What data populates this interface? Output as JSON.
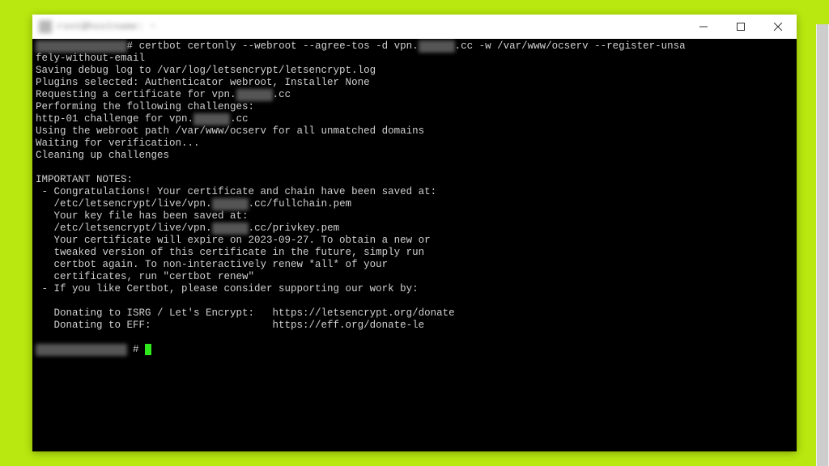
{
  "window": {
    "title": "root@hostname: ~"
  },
  "terminal": {
    "prompt_redacted": "root@████████:~",
    "prompt_hash": "#",
    "cmd_part1": "certbot certonly --webroot --agree-tos -d vpn.",
    "cmd_red1": "██████",
    "cmd_part2": ".cc -w /var/www/ocserv --register-unsa",
    "line2": "fely-without-email",
    "line3": "Saving debug log to /var/log/letsencrypt/letsencrypt.log",
    "line4": "Plugins selected: Authenticator webroot, Installer None",
    "line5a": "Requesting a certificate for vpn.",
    "line5b": ".cc",
    "line6": "Performing the following challenges:",
    "line7a": "http-01 challenge for vpn.",
    "line7b": ".cc",
    "line8": "Using the webroot path /var/www/ocserv for all unmatched domains",
    "line9": "Waiting for verification...",
    "line10": "Cleaning up challenges",
    "blank1": "",
    "notes_header": "IMPORTANT NOTES:",
    "bullet1": " - Congratulations! Your certificate and chain have been saved at:",
    "cert_path_a": "   /etc/letsencrypt/live/vpn.",
    "cert_path_b": ".cc/fullchain.pem",
    "keyfile": "   Your key file has been saved at:",
    "key_path_a": "   /etc/letsencrypt/live/vpn.",
    "key_path_b": ".cc/privkey.pem",
    "expire1": "   Your certificate will expire on 2023-09-27. To obtain a new or",
    "expire2": "   tweaked version of this certificate in the future, simply run",
    "expire3": "   certbot again. To non-interactively renew *all* of your",
    "expire4": "   certificates, run \"certbot renew\"",
    "bullet2": " - If you like Certbot, please consider supporting our work by:",
    "blank2": "",
    "donate1": "   Donating to ISRG / Let's Encrypt:   https://letsencrypt.org/donate",
    "donate2": "   Donating to EFF:                    https://eff.org/donate-le",
    "blank3": "",
    "prompt2_redacted": "root@████████:~",
    "prompt2_hash": "# "
  }
}
